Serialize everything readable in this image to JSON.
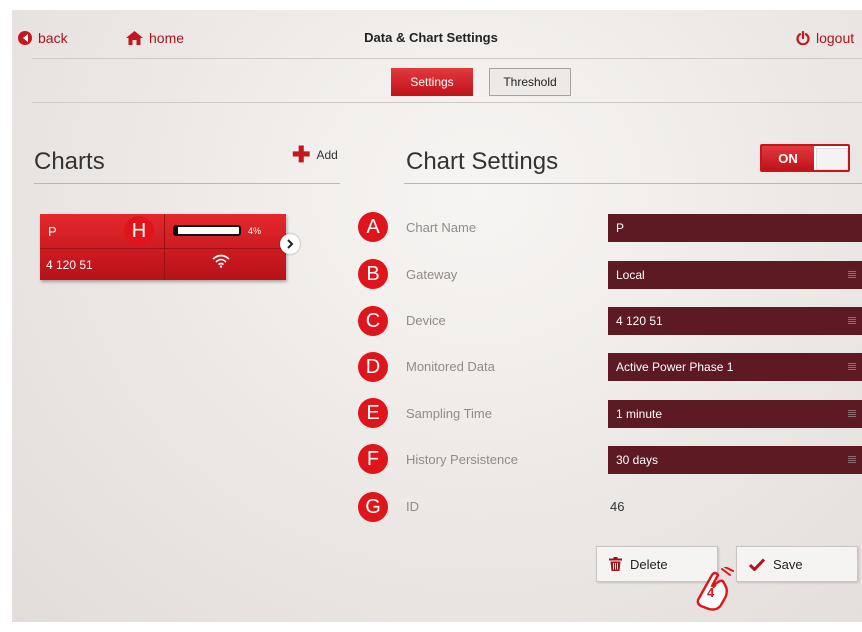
{
  "header": {
    "back_label": "back",
    "home_label": "home",
    "title": "Data & Chart Settings",
    "logout_label": "logout"
  },
  "tabs": [
    {
      "label": "Settings",
      "active": true
    },
    {
      "label": "Threshold",
      "active": false
    }
  ],
  "charts_panel": {
    "title": "Charts",
    "add_label": "Add",
    "card": {
      "name": "P",
      "battery_percent_label": "4%",
      "battery_fraction": 0.04,
      "device": "4 120 51",
      "signal_icon": "wifi-icon"
    }
  },
  "settings_panel": {
    "title": "Chart Settings",
    "toggle_label": "ON",
    "rows": [
      {
        "badge": "A",
        "label": "Chart Name",
        "value": "P"
      },
      {
        "badge": "B",
        "label": "Gateway",
        "value": "Local"
      },
      {
        "badge": "C",
        "label": "Device",
        "value": "4 120 51"
      },
      {
        "badge": "D",
        "label": "Monitored Data",
        "value": "Active Power Phase 1"
      },
      {
        "badge": "E",
        "label": "Sampling Time",
        "value": "1 minute"
      },
      {
        "badge": "F",
        "label": "History Persistence",
        "value": "30 days"
      },
      {
        "badge": "G",
        "label": "ID",
        "value": "46"
      }
    ],
    "delete_label": "Delete",
    "save_label": "Save"
  },
  "annotations": {
    "card_badge": "H",
    "step_label": "4"
  },
  "colors": {
    "accent": "#c4161c",
    "field_bg": "#5d1a22",
    "badge": "#e0141b"
  }
}
